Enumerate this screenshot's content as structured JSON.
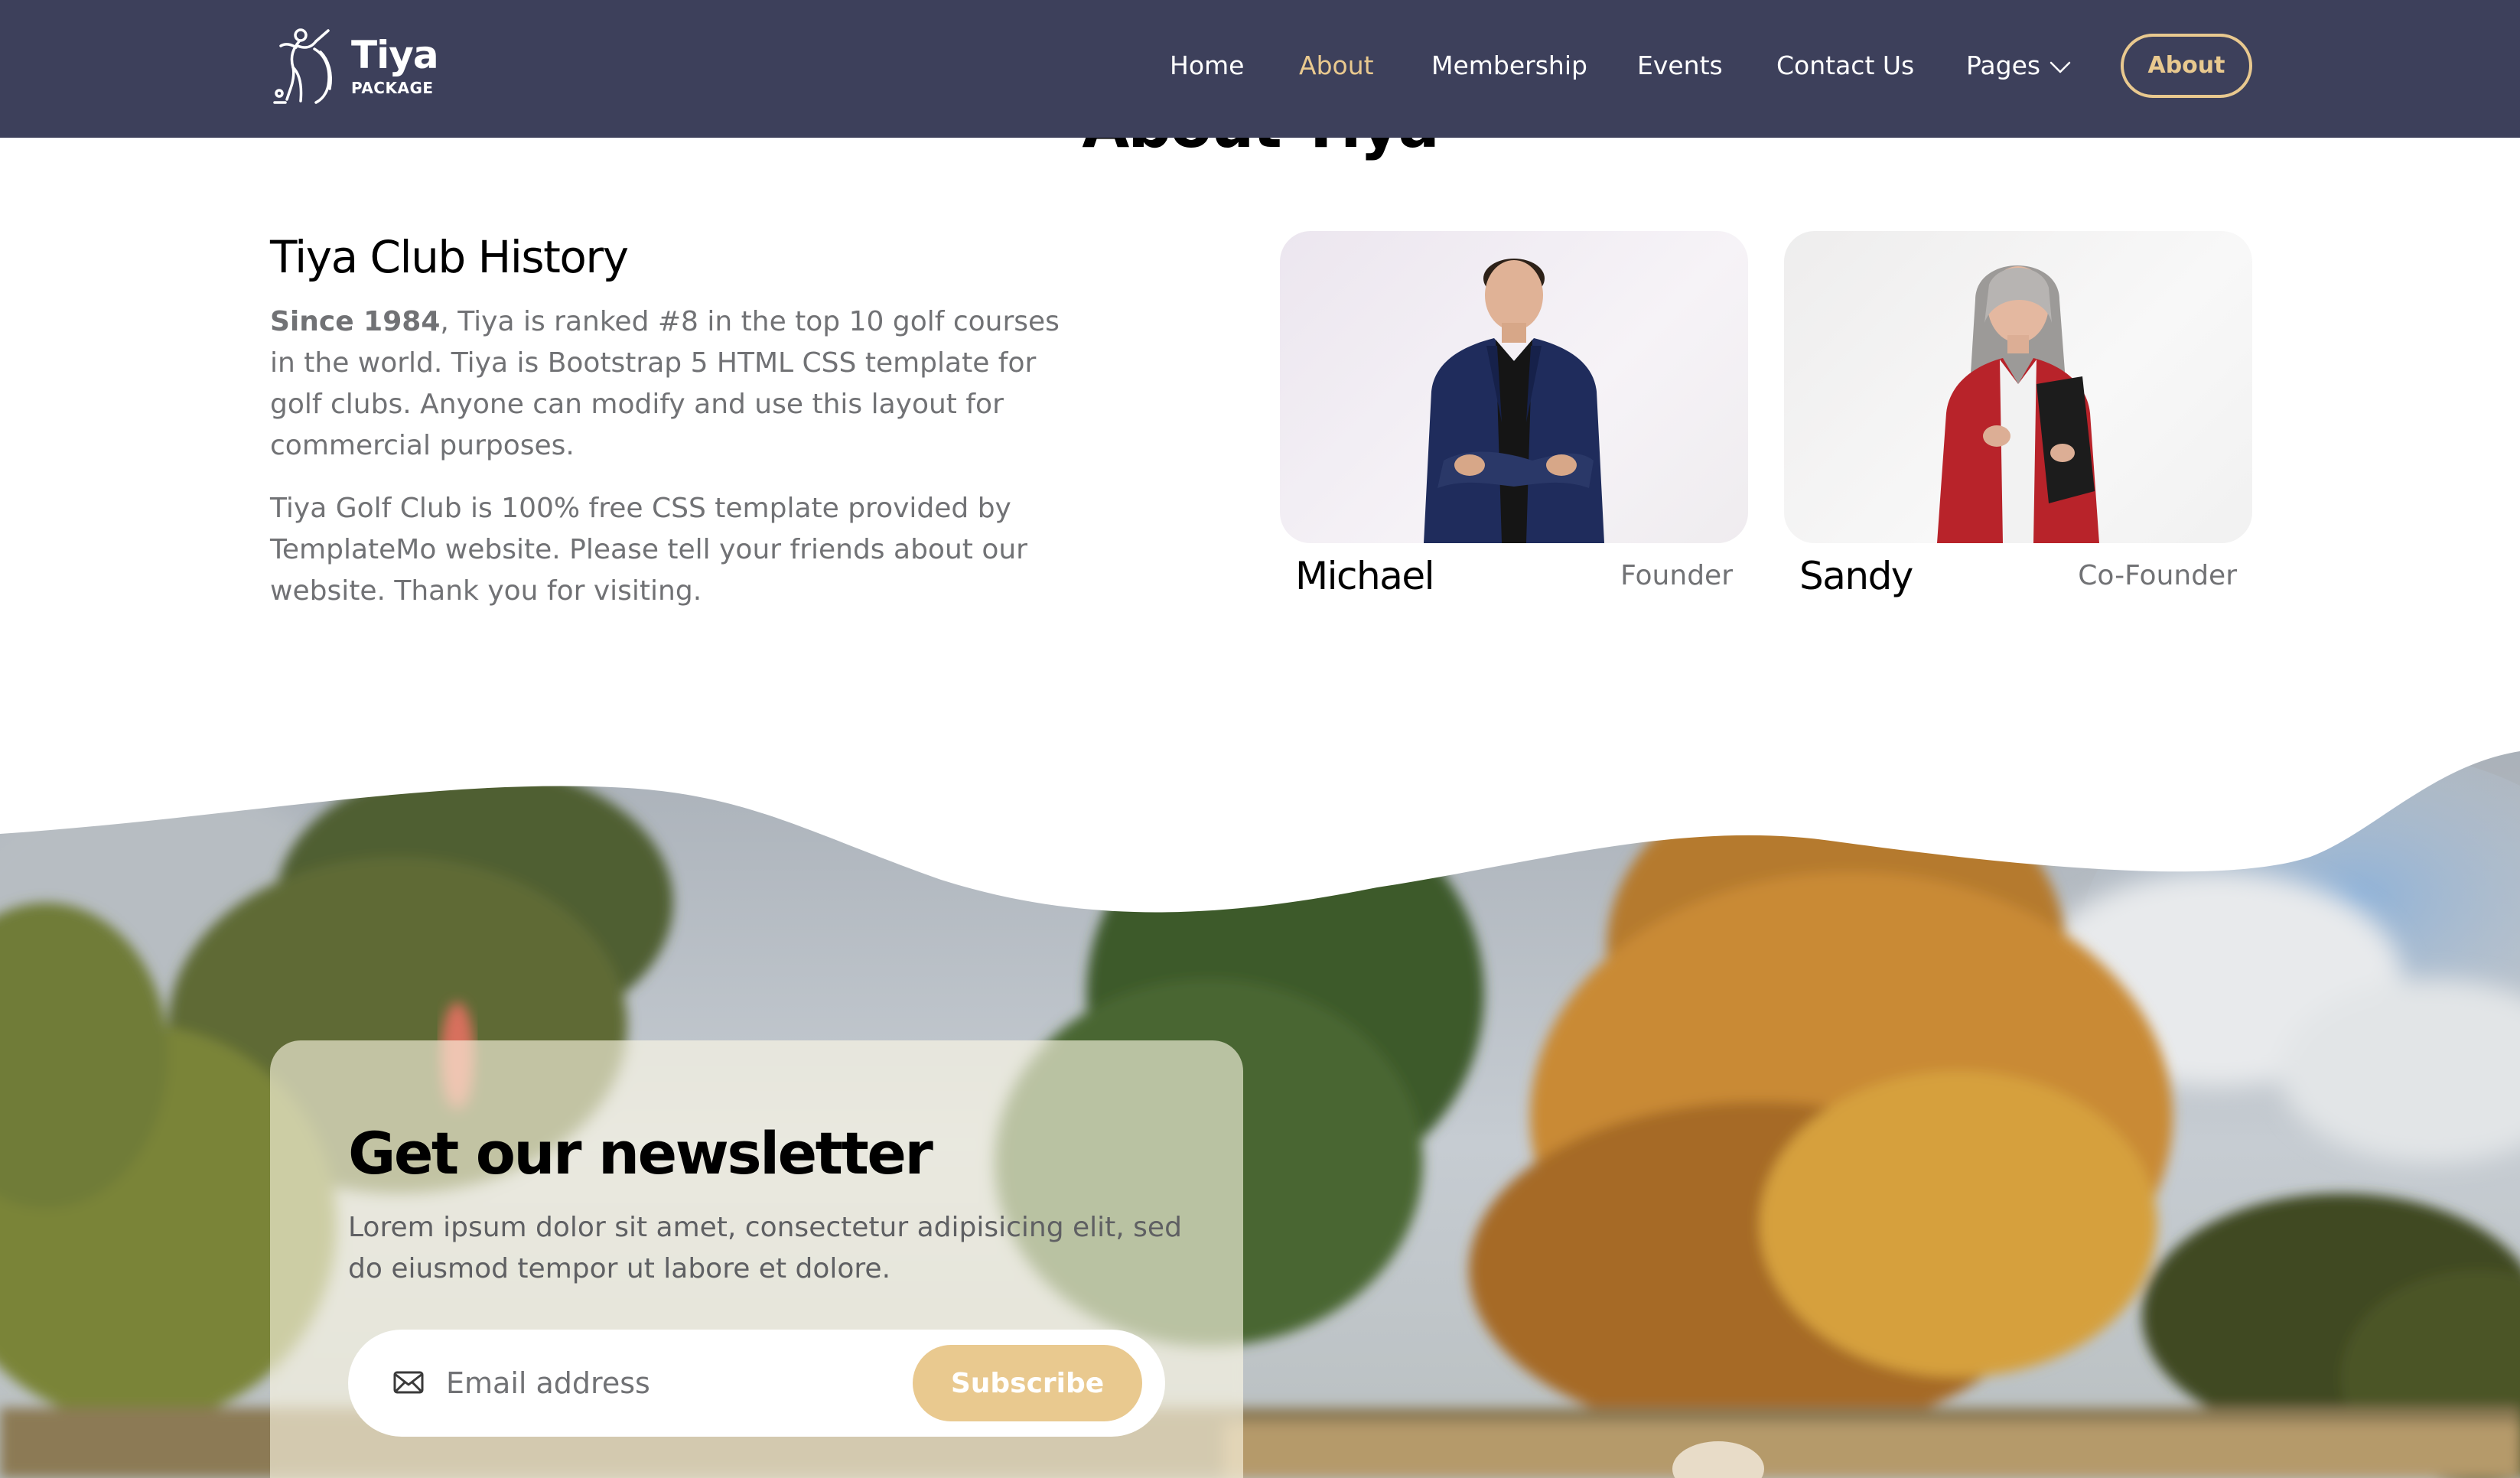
{
  "brand": {
    "name": "Tiya",
    "tagline": "PACKAGE",
    "logo_icon": "golfer-swing-icon"
  },
  "nav": {
    "items": [
      {
        "label": "Home",
        "active": false
      },
      {
        "label": "About",
        "active": true
      },
      {
        "label": "Membership",
        "active": false
      },
      {
        "label": "Events",
        "active": false
      },
      {
        "label": "Contact Us",
        "active": false
      },
      {
        "label": "Pages",
        "active": false,
        "dropdown": true
      }
    ],
    "button_label": "About"
  },
  "about": {
    "section_title": "About Tiya",
    "history_title": "Tiya Club History",
    "history_lead_bold": "Since 1984",
    "history_p1_rest": ", Tiya is ranked #8 in the top 10 golf courses in the world. Tiya is Bootstrap 5 HTML CSS template for golf clubs. Anyone can modify and use this layout for commercial purposes.",
    "history_p2": "Tiya Golf Club is 100% free CSS template provided by TemplateMo website. Please tell your friends about our website. Thank you for visiting."
  },
  "team": [
    {
      "name": "Michael",
      "role": "Founder"
    },
    {
      "name": "Sandy",
      "role": "Co-Founder"
    }
  ],
  "newsletter": {
    "title": "Get our newsletter",
    "text": "Lorem ipsum dolor sit amet, consectetur adipisicing elit, sed do eiusmod tempor ut labore et dolore.",
    "email_placeholder": "Email address",
    "subscribe_label": "Subscribe"
  },
  "colors": {
    "navbar_bg": "#3d405b",
    "accent": "#e9c98f",
    "text_muted": "#717275",
    "heading": "#000000"
  }
}
